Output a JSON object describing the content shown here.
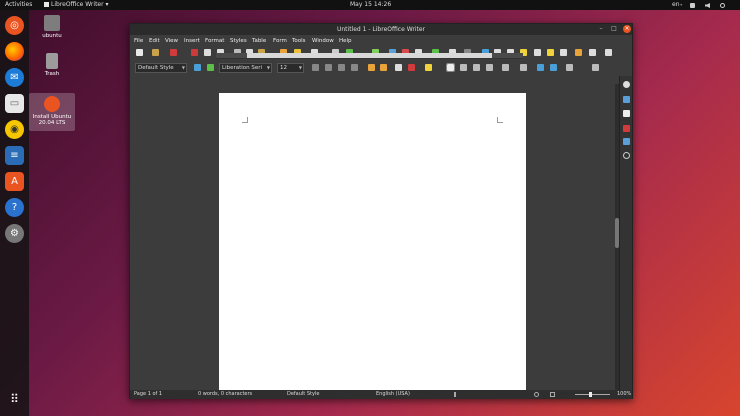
{
  "topbar": {
    "activities": "Activities",
    "app_menu": "LibreOffice Writer",
    "clock": "May 15  14:26",
    "lang": "en₊",
    "status_icons": [
      "network-icon",
      "volume-icon",
      "power-icon"
    ]
  },
  "desktop": {
    "icons": [
      {
        "label": "ubuntu",
        "icon": "home-folder-icon"
      },
      {
        "label": "Trash",
        "icon": "trash-icon"
      },
      {
        "label": "Install Ubuntu 20.04 LTS",
        "icon": "installer-icon"
      }
    ]
  },
  "dock": {
    "items": [
      "ubuntu-icon",
      "firefox-icon",
      "thunderbird-icon",
      "files-icon",
      "rhythmbox-icon",
      "writer-icon",
      "software-icon",
      "help-icon",
      "settings-icon",
      "apps-grid-icon"
    ]
  },
  "window": {
    "title": "Untitled 1 - LibreOffice Writer"
  },
  "menu": {
    "items": [
      "File",
      "Edit",
      "View",
      "Insert",
      "Format",
      "Styles",
      "Table",
      "Form",
      "Tools",
      "Window",
      "Help"
    ]
  },
  "format": {
    "paragraph_style": "Default Style",
    "font_name": "Liberation Seri",
    "font_size": "12"
  },
  "statusbar": {
    "page": "Page 1 of 1",
    "words": "0 words, 0 characters",
    "style": "Default Style",
    "language": "English (USA)",
    "zoom": "100%"
  },
  "colors": {
    "accent_orange": "#e95420",
    "dock_bg": "#1a1a1a"
  }
}
